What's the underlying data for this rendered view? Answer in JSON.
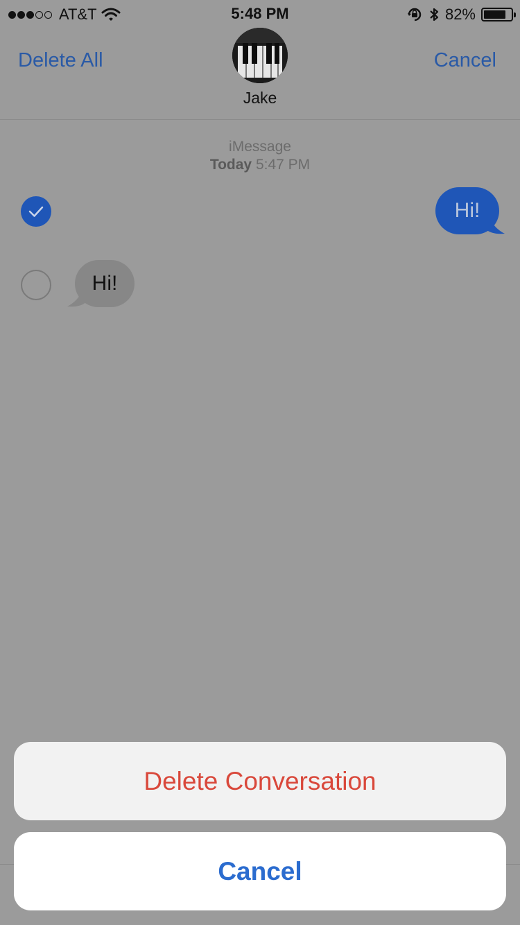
{
  "status_bar": {
    "carrier": "AT&T",
    "time": "5:48 PM",
    "battery_percent": "82%",
    "battery_level": 0.82,
    "signal_dots_filled": 3,
    "signal_dots_total": 5
  },
  "nav": {
    "delete_all_label": "Delete All",
    "cancel_label": "Cancel",
    "contact_name": "Jake"
  },
  "conversation": {
    "service": "iMessage",
    "day": "Today",
    "time": "5:47 PM",
    "messages": [
      {
        "text": "Hi!",
        "direction": "outgoing",
        "selected": true
      },
      {
        "text": "Hi!",
        "direction": "incoming",
        "selected": false
      }
    ]
  },
  "action_sheet": {
    "delete_label": "Delete Conversation",
    "cancel_label": "Cancel"
  },
  "colors": {
    "accent": "#2a5aa6",
    "destructive": "#d9483b",
    "bubble_out": "#1f56b7",
    "dim_background": "#9b9b9b"
  }
}
